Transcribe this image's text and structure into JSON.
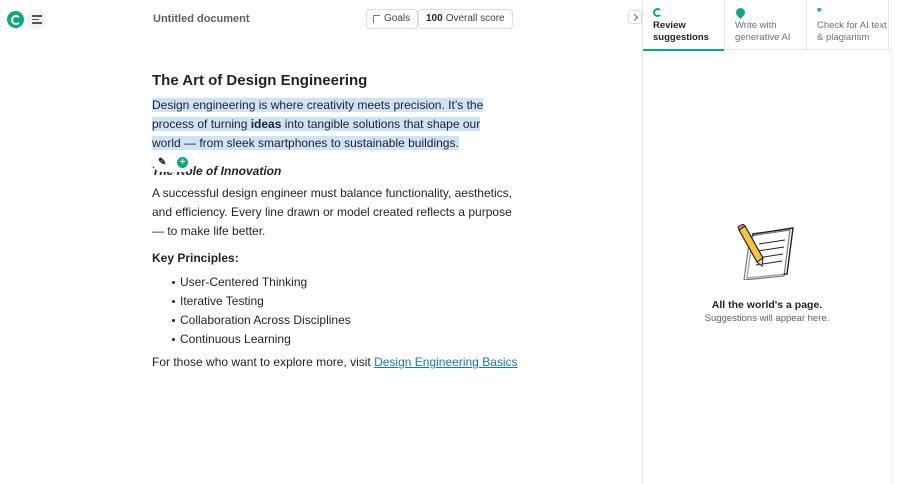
{
  "header": {
    "doc_title": "Untitled document",
    "goals_label": "Goals",
    "score_value": "100",
    "score_label": "Overall score"
  },
  "document": {
    "heading": "The Art of Design Engineering",
    "para1_part1": "Design engineering is where creativity meets precision. It’s the process of turning ",
    "para1_bold": "ideas",
    "para1_part2": " into tangible solutions that shape our world — from sleek smartphones to sustainable buildings.",
    "subheading": "The Role of Innovation",
    "para2": "A successful design engineer must balance functionality, aesthetics, and efficiency. Every line drawn or model created reflects a purpose — to make life better.",
    "principles_heading": "Key Principles:",
    "principles": [
      "User-Centered Thinking",
      "Iterative Testing",
      "Collaboration Across Disciplines",
      "Continuous Learning"
    ],
    "para3_text": "For those who want to explore more, visit ",
    "para3_link": "Design Engineering Basics"
  },
  "sidebar": {
    "tabs": [
      {
        "label": "Review suggestions",
        "icon": "grammarly-icon",
        "active": true
      },
      {
        "label": "Write with generative AI",
        "icon": "pin-icon",
        "active": false
      },
      {
        "label": "Check for AI text & plagiarism",
        "icon": "quote-icon",
        "active": false
      }
    ],
    "empty_title": "All the world's a page.",
    "empty_subtitle": "Suggestions will appear here."
  },
  "colors": {
    "accent": "#11a683",
    "highlight": "#cfe3f6",
    "link": "#1a73c8"
  }
}
